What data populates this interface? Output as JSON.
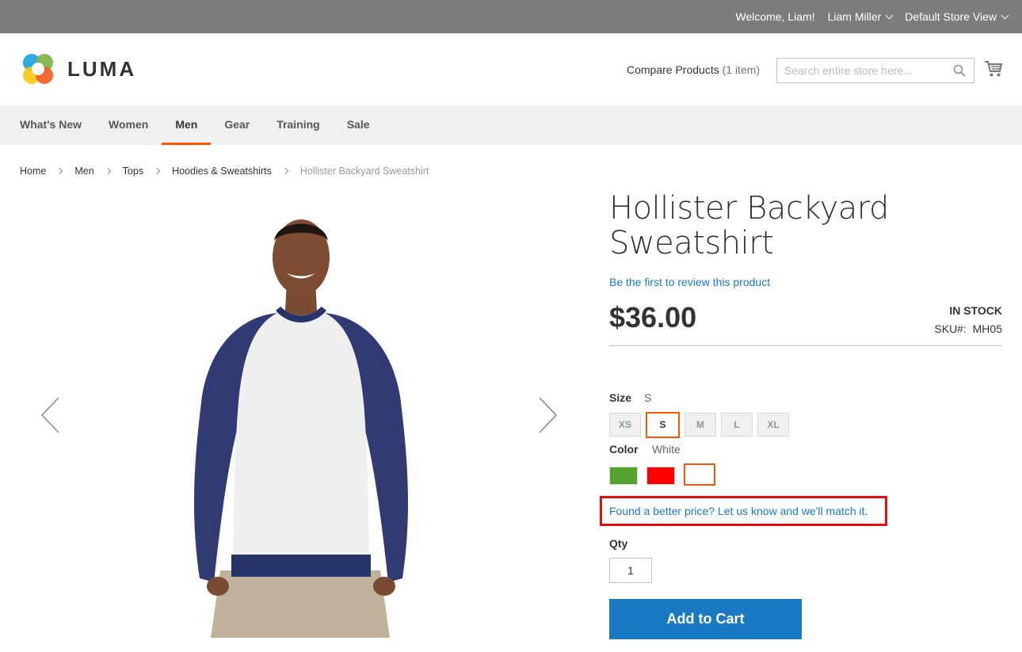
{
  "topbar": {
    "welcome": "Welcome, Liam!",
    "account_name": "Liam Miller",
    "store_view": "Default Store View"
  },
  "header": {
    "logo_text": "LUMA",
    "compare_label": "Compare Products",
    "compare_count": "(1 item)",
    "search_placeholder": "Search entire store here..."
  },
  "nav": {
    "items": [
      {
        "label": "What's New"
      },
      {
        "label": "Women"
      },
      {
        "label": "Men",
        "active": true
      },
      {
        "label": "Gear"
      },
      {
        "label": "Training"
      },
      {
        "label": "Sale"
      }
    ]
  },
  "breadcrumbs": [
    "Home",
    "Men",
    "Tops",
    "Hoodies & Sweatshirts",
    "Hollister Backyard Sweatshirt"
  ],
  "product": {
    "title": "Hollister Backyard Sweatshirt",
    "review_link": "Be the first to review this product",
    "price": "$36.00",
    "stock": "IN STOCK",
    "sku_label": "SKU#:",
    "sku": "MH05",
    "size_label": "Size",
    "size_selected": "S",
    "sizes": [
      "XS",
      "S",
      "M",
      "L",
      "XL"
    ],
    "color_label": "Color",
    "color_selected": "White",
    "colors": [
      {
        "name": "Green",
        "hex": "#53a42d"
      },
      {
        "name": "Red",
        "hex": "#ff0000"
      },
      {
        "name": "White",
        "hex": "#ffffff",
        "selected": true
      }
    ],
    "price_match_link": "Found a better price? Let us know and we'll match it.",
    "qty_label": "Qty",
    "qty_value": "1",
    "add_to_cart": "Add to Cart"
  },
  "colors": {
    "accent": "#ff5501",
    "link": "#1979c3",
    "highlight_box": "#e01010",
    "topbar": "#7c7c7a"
  }
}
